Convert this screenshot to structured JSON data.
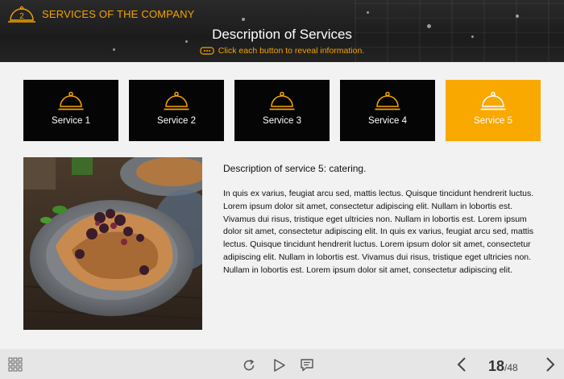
{
  "header": {
    "badge_number": "2",
    "course_title": "SERVICES OF THE COMPANY",
    "page_heading": "Description of Services",
    "hint": "Click each button to reveal information."
  },
  "services": [
    {
      "label": "Service 1",
      "active": false
    },
    {
      "label": "Service 2",
      "active": false
    },
    {
      "label": "Service 3",
      "active": false
    },
    {
      "label": "Service 4",
      "active": false
    },
    {
      "label": "Service 5",
      "active": true
    }
  ],
  "content": {
    "title": "Description of service 5: catering.",
    "body": "In quis ex varius, feugiat arcu sed, mattis lectus. Quisque tincidunt hendrerit luctus. Lorem ipsum dolor sit amet, consectetur adipiscing elit. Nullam in lobortis est. Vivamus dui risus, tristique eget ultricies non. Nullam in lobortis est. Lorem ipsum dolor sit amet, consectetur adipiscing elit. In quis ex varius, feugiat arcu sed, mattis lectus. Quisque tincidunt hendrerit luctus. Lorem ipsum dolor sit amet, consectetur adipiscing elit. Nullam in lobortis est. Vivamus dui risus, tristique eget ultricies non. Nullam in lobortis est. Lorem ipsum dolor sit amet, consectetur adipiscing elit."
  },
  "footer": {
    "current_page": "18",
    "total_pages": "/48"
  },
  "icons": {
    "menu": "grid-menu-icon",
    "replay": "replay-icon",
    "play": "play-icon",
    "notes": "notes-icon",
    "prev": "chevron-left-icon",
    "next": "chevron-right-icon",
    "service": "cloche-icon"
  },
  "colors": {
    "accent": "#f9a800",
    "button_bg": "#050505",
    "header_bg": "#222222"
  }
}
